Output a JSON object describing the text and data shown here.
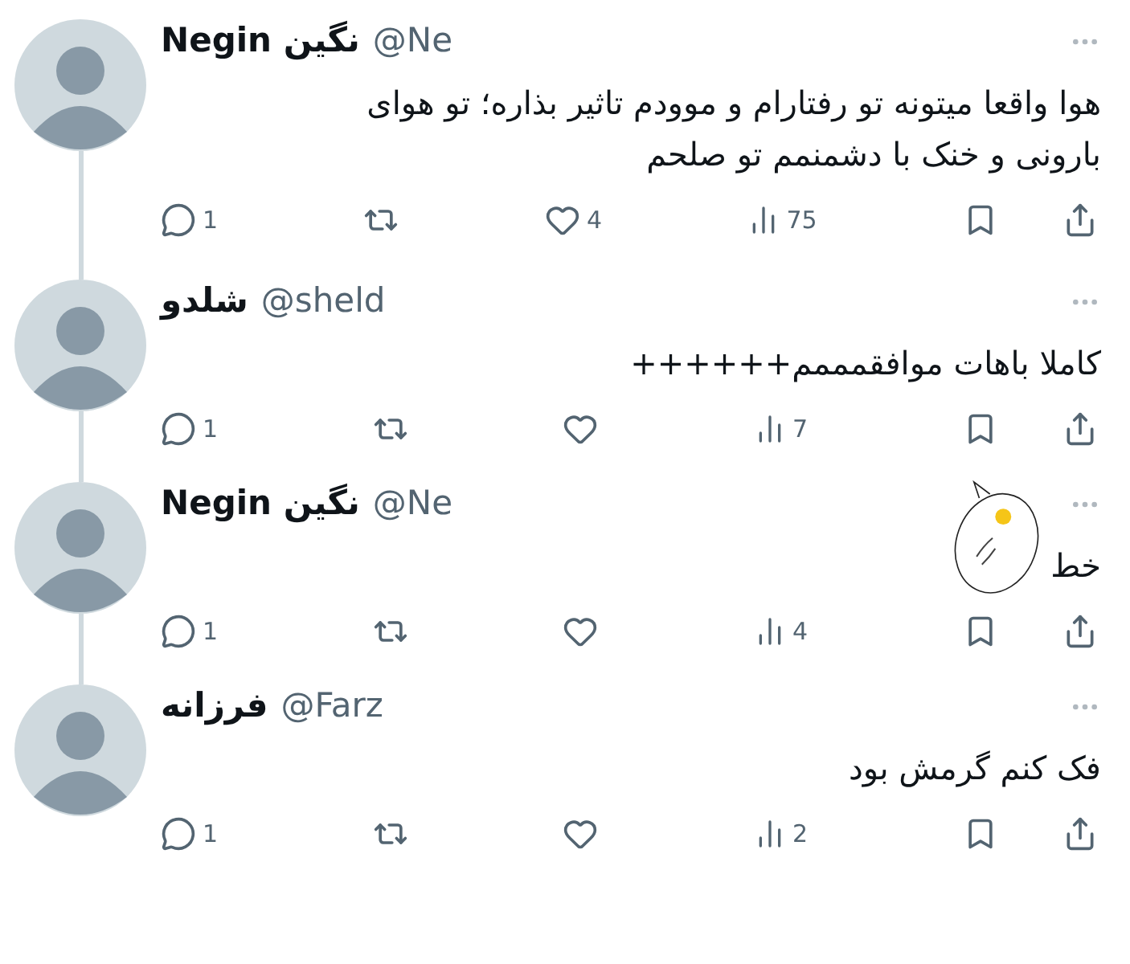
{
  "tweets": [
    {
      "name": "Negin نگین",
      "handle": "@Ne",
      "text": "هوا واقعا میتونه تو رفتارام و موودم تاثیر بذاره؛ تو هوای بارونی و خنک با دشمنمم تو صلحم",
      "replies": "1",
      "likes": "4",
      "views": "75",
      "sticker": false
    },
    {
      "name": "شلدو",
      "handle": "@sheld",
      "text": "کاملا باهات موافقمممم++++++",
      "replies": "1",
      "views": "7",
      "sticker": false
    },
    {
      "name": "Negin نگین",
      "handle": "@Ne",
      "text": "خط",
      "replies": "1",
      "views": "4",
      "sticker": true
    },
    {
      "name": "فرزانه",
      "handle": "@Farz",
      "text": "فک کنم گرمش بود",
      "replies": "1",
      "views": "2",
      "sticker": false
    }
  ]
}
